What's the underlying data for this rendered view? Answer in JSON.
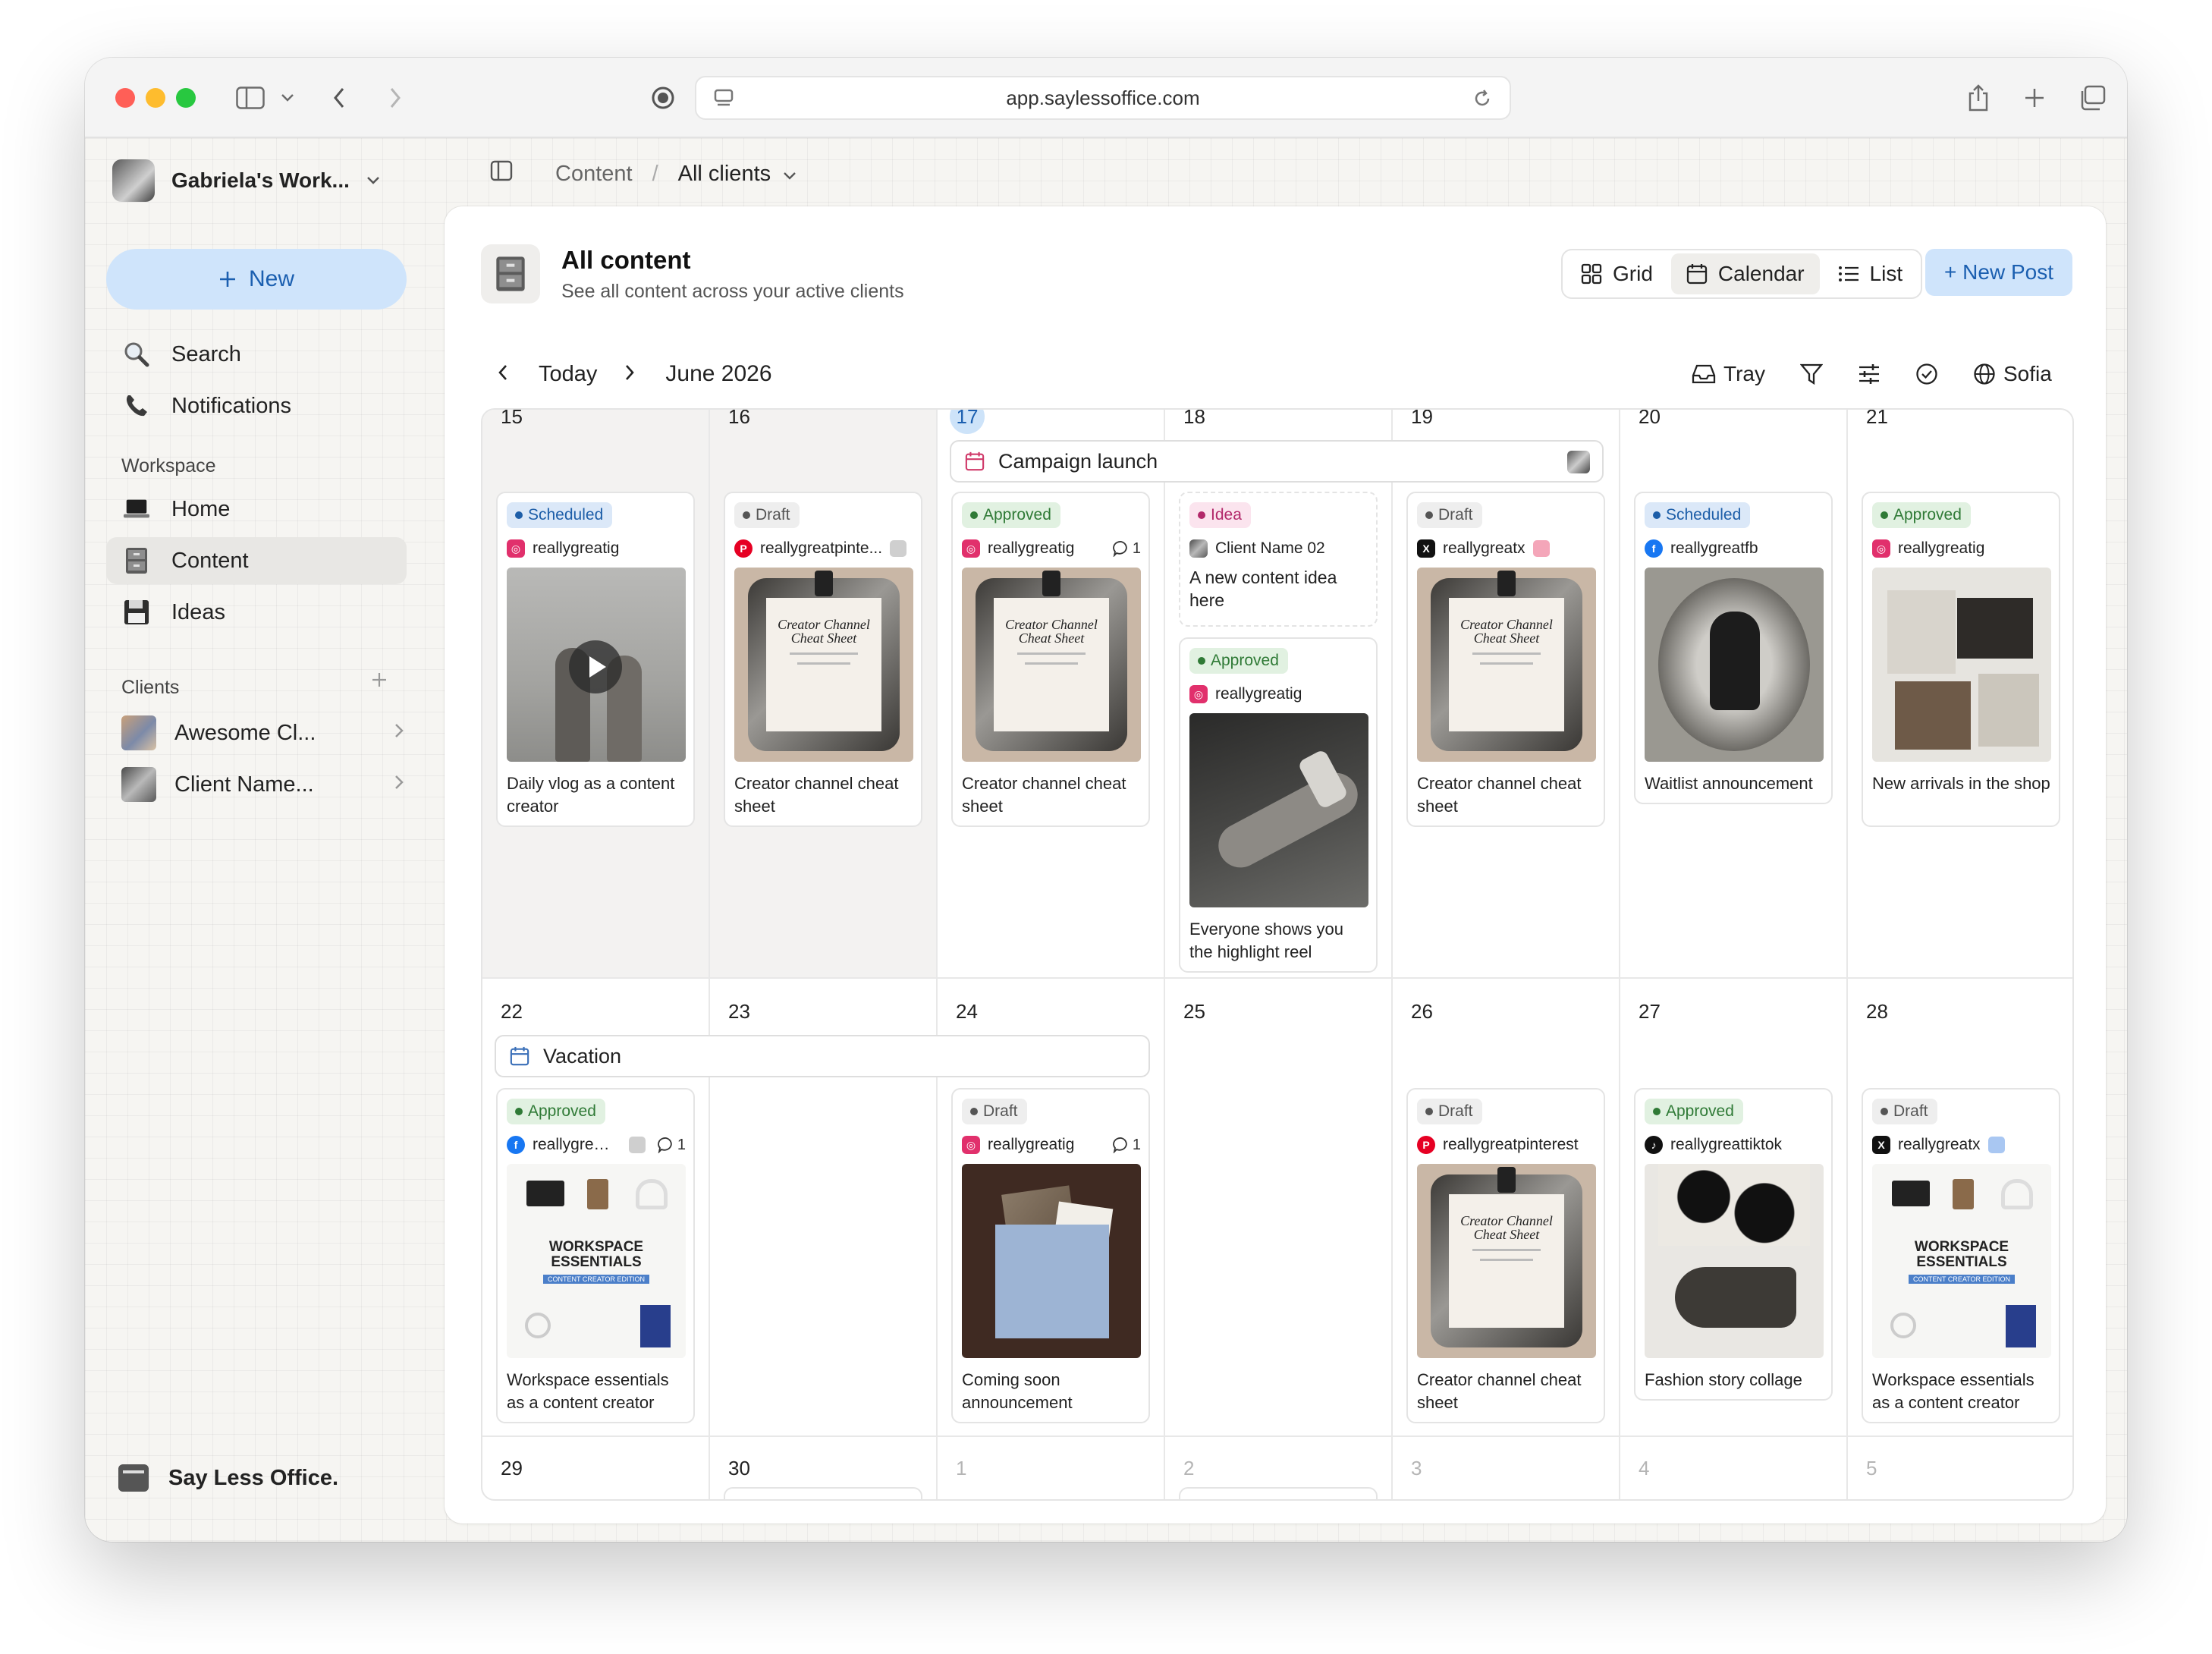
{
  "browser": {
    "url": "app.saylessoffice.com"
  },
  "sidebar": {
    "workspace_name": "Gabriela's Work...",
    "new_label": "New",
    "nav_top": [
      {
        "label": "Search",
        "icon": "search-icon"
      },
      {
        "label": "Notifications",
        "icon": "phone-icon"
      }
    ],
    "workspace_label": "Workspace",
    "workspace_items": [
      {
        "label": "Home",
        "icon": "laptop-icon"
      },
      {
        "label": "Content",
        "icon": "cabinet-icon",
        "active": true
      },
      {
        "label": "Ideas",
        "icon": "floppy-disk-icon"
      }
    ],
    "clients_label": "Clients",
    "clients": [
      {
        "label": "Awesome Cl..."
      },
      {
        "label": "Client Name..."
      }
    ],
    "brand": "Say Less Office."
  },
  "breadcrumb": {
    "root": "Content",
    "separator": "/",
    "current": "All clients"
  },
  "header": {
    "title": "All content",
    "subtitle": "See all content across your active clients",
    "views": [
      {
        "label": "Grid",
        "icon": "grid-icon"
      },
      {
        "label": "Calendar",
        "icon": "calendar-icon",
        "active": true
      },
      {
        "label": "List",
        "icon": "list-icon"
      }
    ],
    "new_post": "+ New Post"
  },
  "calendar": {
    "today_label": "Today",
    "month_label": "June 2026",
    "tools": {
      "tray": "Tray",
      "timezone": "Sofia"
    },
    "weeks": [
      [
        "15",
        "16",
        "17",
        "18",
        "19",
        "20",
        "21"
      ],
      [
        "22",
        "23",
        "24",
        "25",
        "26",
        "27",
        "28"
      ],
      [
        "29",
        "30",
        "1",
        "2",
        "3",
        "4",
        "5"
      ]
    ],
    "today": "17",
    "events": [
      {
        "label": "Campaign launch"
      },
      {
        "label": "Vacation"
      }
    ],
    "cards": [
      {
        "status": "Scheduled",
        "platform": "instagram",
        "account": "reallygreatig",
        "caption": "Daily vlog as a content creator",
        "thumb": "vlog"
      },
      {
        "status": "Draft",
        "platform": "pinterest",
        "account": "reallygreatpinte...",
        "caption": "Creator channel cheat sheet",
        "thumb": "cheat"
      },
      {
        "status": "Approved",
        "platform": "instagram",
        "account": "reallygreatig",
        "comments": "1",
        "caption": "Creator channel cheat sheet",
        "thumb": "cheat"
      },
      {
        "status": "Idea",
        "client": "Client Name 02",
        "caption": "A new content idea here"
      },
      {
        "status": "Approved",
        "platform": "instagram",
        "account": "reallygreatig",
        "caption": "Everyone shows you the highlight reel",
        "thumb": "hand"
      },
      {
        "status": "Draft",
        "platform": "x",
        "account": "reallygreatx",
        "caption": "Creator channel cheat sheet",
        "thumb": "cheat"
      },
      {
        "status": "Scheduled",
        "platform": "facebook",
        "account": "reallygreatfb",
        "caption": "Waitlist announcement",
        "thumb": "plate"
      },
      {
        "status": "Approved",
        "platform": "instagram",
        "account": "reallygreatig",
        "caption": "New arrivals in the shop",
        "thumb": "arrivals"
      },
      {
        "status": "Approved",
        "platform": "facebook",
        "account": "reallygreatfb",
        "comments": "1",
        "caption": "Workspace essentials as a content creator",
        "thumb": "workspace"
      },
      {
        "status": "Draft",
        "platform": "instagram",
        "account": "reallygreatig",
        "comments": "1",
        "caption": "Coming soon announcement",
        "thumb": "envelope"
      },
      {
        "status": "Draft",
        "platform": "pinterest",
        "account": "reallygreatpinterest",
        "caption": "Creator channel cheat sheet",
        "thumb": "cheat"
      },
      {
        "status": "Approved",
        "platform": "tiktok",
        "account": "reallygreattiktok",
        "caption": "Fashion story collage",
        "thumb": "fashion"
      },
      {
        "status": "Draft",
        "platform": "x",
        "account": "reallygreatx",
        "caption": "Workspace essentials as a content creator",
        "thumb": "workspace"
      }
    ],
    "thumb_text": {
      "cheat_title": "Creator Channel Cheat Sheet",
      "workspace_title": "WORKSPACE ESSENTIALS",
      "workspace_sub": "CONTENT CREATOR EDITION"
    }
  }
}
